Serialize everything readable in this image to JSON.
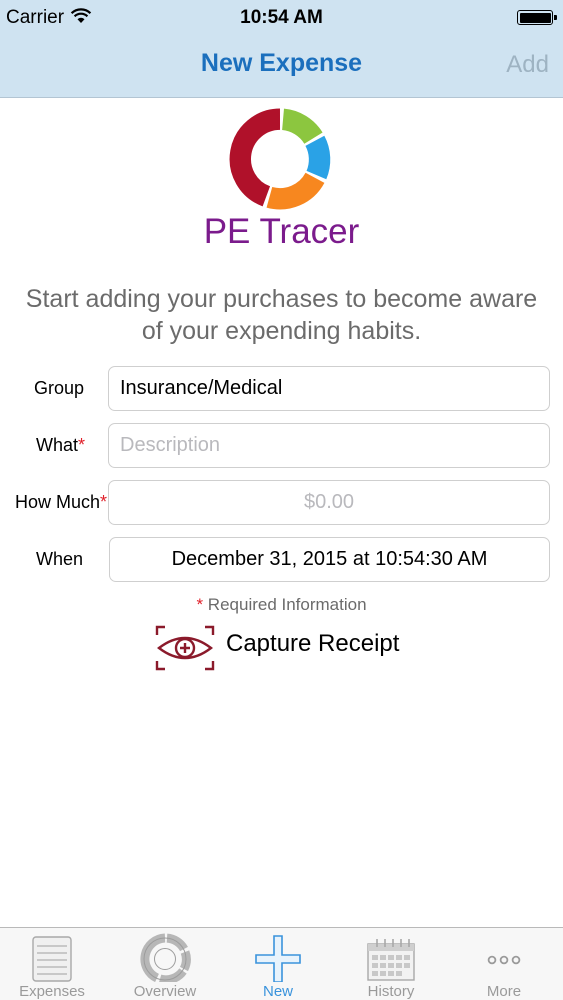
{
  "status_bar": {
    "carrier": "Carrier",
    "time": "10:54 AM"
  },
  "nav": {
    "title": "New Expense",
    "add_label": "Add"
  },
  "brand": {
    "app_name": "PE Tracer",
    "tagline": "Start adding your purchases to become aware of your expending habits.",
    "logo_colors": [
      "#b0112a",
      "#8cc63f",
      "#2aa2e6",
      "#f7871f"
    ]
  },
  "form": {
    "group": {
      "label": "Group",
      "value": "Insurance/Medical"
    },
    "what": {
      "label": "What",
      "required_mark": "*",
      "placeholder": "Description"
    },
    "how_much": {
      "label": "How Much",
      "required_mark": "*",
      "placeholder": "$0.00"
    },
    "when": {
      "label": "When",
      "value": "December 31, 2015 at 10:54:30 AM"
    },
    "required_note": {
      "mark": "*",
      "text": "Required Information"
    }
  },
  "capture": {
    "label": "Capture Receipt",
    "icon": "eye-scan-icon",
    "color": "#8b1a2b"
  },
  "tabbar": {
    "active": "New",
    "tabs": [
      {
        "label": "Expenses",
        "icon": "list-icon"
      },
      {
        "label": "Overview",
        "icon": "donut-chart-icon"
      },
      {
        "label": "New",
        "icon": "plus-icon"
      },
      {
        "label": "History",
        "icon": "calendar-icon"
      },
      {
        "label": "More",
        "icon": "more-dots-icon"
      }
    ]
  },
  "colors": {
    "nav_background": "#cfe3f1",
    "accent": "#1b6fbd",
    "brand_purple": "#7b1b8c",
    "required_red": "#e0202a",
    "tab_active": "#3a93dc",
    "tab_inactive": "#9a9a9a"
  }
}
